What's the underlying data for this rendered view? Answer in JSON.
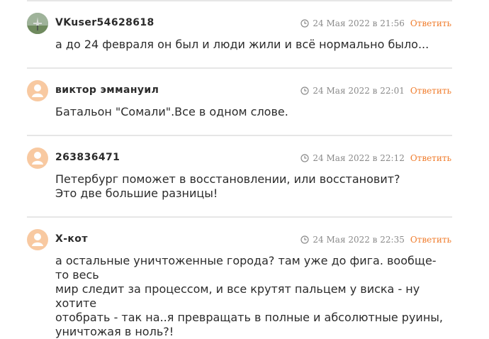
{
  "comments": [
    {
      "author": "VKuser54628618",
      "avatar": "photo",
      "date": "24 Мая 2022 в 21:56",
      "reply_label": "Ответить",
      "lines": [
        "а до 24 февраля он был и люди жили и всё нормально было..."
      ]
    },
    {
      "author": "виктор эммануил",
      "avatar": "default",
      "date": "24 Мая 2022 в 22:01",
      "reply_label": "Ответить",
      "lines": [
        "Батальон \"Сомали\".Все в одном слове."
      ]
    },
    {
      "author": "263836471",
      "avatar": "default",
      "date": "24 Мая 2022 в 22:12",
      "reply_label": "Ответить",
      "lines": [
        "Петербург поможет в восстановлении, или восстановит?",
        "Это две большие разницы!"
      ]
    },
    {
      "author": "Х-кот",
      "avatar": "default",
      "date": "24 Мая 2022 в 22:35",
      "reply_label": "Ответить",
      "lines": [
        "а остальные уничтоженные города? там уже до фига. вообще-то весь",
        "мир следит за процессом, и все крутят пальцем у виска - ну хотите",
        "отобрать - так на..я превращать в полные и абсолютные руины,",
        "уничтожая в ноль?!"
      ]
    }
  ],
  "colors": {
    "accent": "#f07c2c",
    "avatar_default": "#f8c9a1",
    "divider": "#e6e6e6"
  },
  "icons": {
    "clock": "clock-icon",
    "avatar": "user-avatar-icon"
  }
}
